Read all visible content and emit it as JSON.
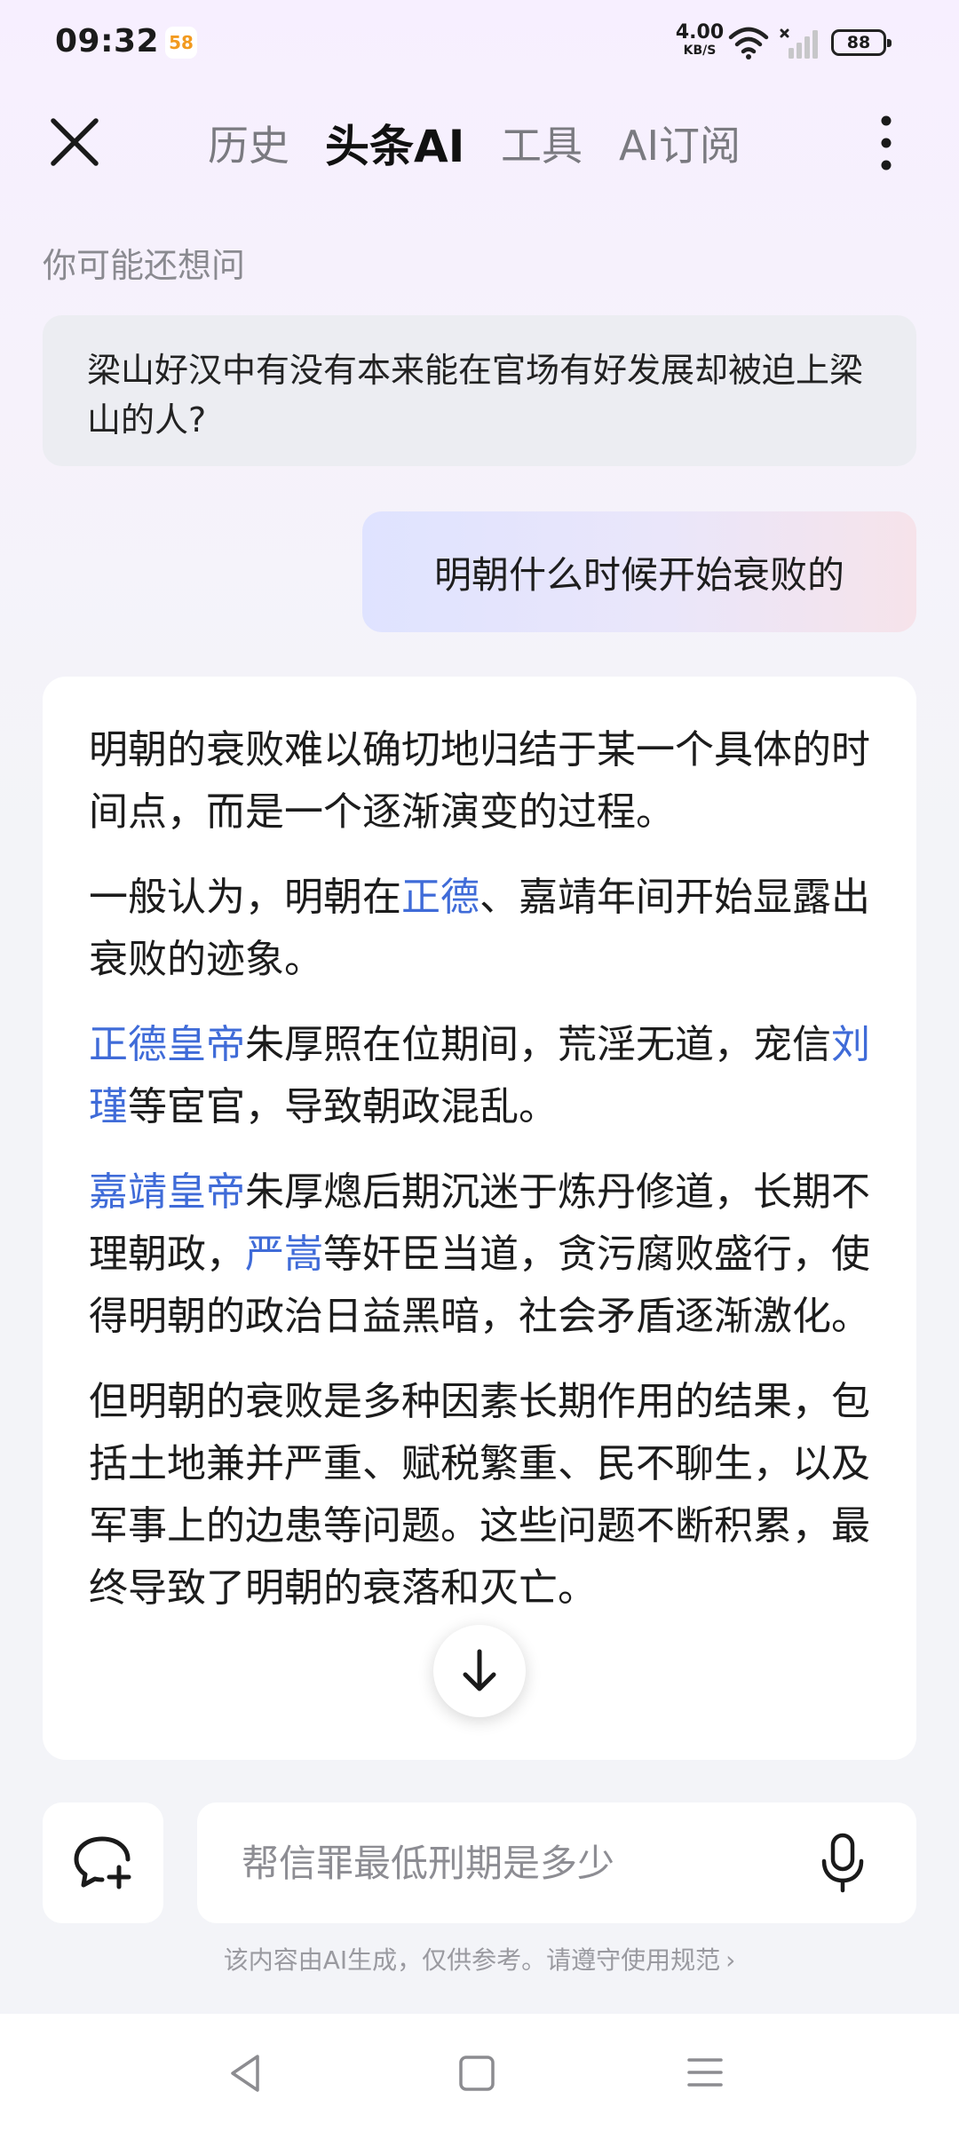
{
  "status_bar": {
    "time": "09:32",
    "app_badge": "58",
    "net_speed": "4.00",
    "net_unit": "KB/S",
    "battery": "88"
  },
  "nav": {
    "tabs": [
      {
        "label": "历史"
      },
      {
        "label": "头条AI",
        "active": true
      },
      {
        "label": "工具"
      },
      {
        "label": "AI订阅"
      }
    ]
  },
  "suggestion": {
    "title": "你可能还想问",
    "question": "梁山好汉中有没有本来能在官场有好发展却被迫上梁山的人?"
  },
  "user_message": "明朝什么时候开始衰败的",
  "answer": {
    "p1": "明朝的衰败难以确切地归结于某一个具体的时间点，而是一个逐渐演变的过程。",
    "p2": {
      "before": "一般认为，明朝在",
      "link": "正德",
      "after": "、嘉靖年间开始显露出衰败的迹象。"
    },
    "p3": {
      "link1": "正德皇帝",
      "text1": "朱厚照在位期间，荒淫无道，宠信",
      "link2": "刘瑾",
      "text2": "等宦官，导致朝政混乱。"
    },
    "p4": {
      "link1": "嘉靖皇帝",
      "text1": "朱厚熜后期沉迷于炼丹修道，长期不理朝政，",
      "link2": "严嵩",
      "text2": "等奸臣当道，贪污腐败盛行，使得明朝的政治日益黑暗，社会矛盾逐渐激化。"
    },
    "p5": "但明朝的衰败是多种因素长期作用的结果，包括土地兼并严重、赋税繁重、民不聊生，以及军事上的边患等问题。这些问题不断积累，最终导致了明朝的衰落和灭亡。"
  },
  "input": {
    "placeholder": "帮信罪最低刑期是多少"
  },
  "disclaimer": "该内容由AI生成，仅供参考。请遵守使用规范",
  "colors": {
    "link": "#3f6bd8",
    "badge": "#f29a1f"
  }
}
